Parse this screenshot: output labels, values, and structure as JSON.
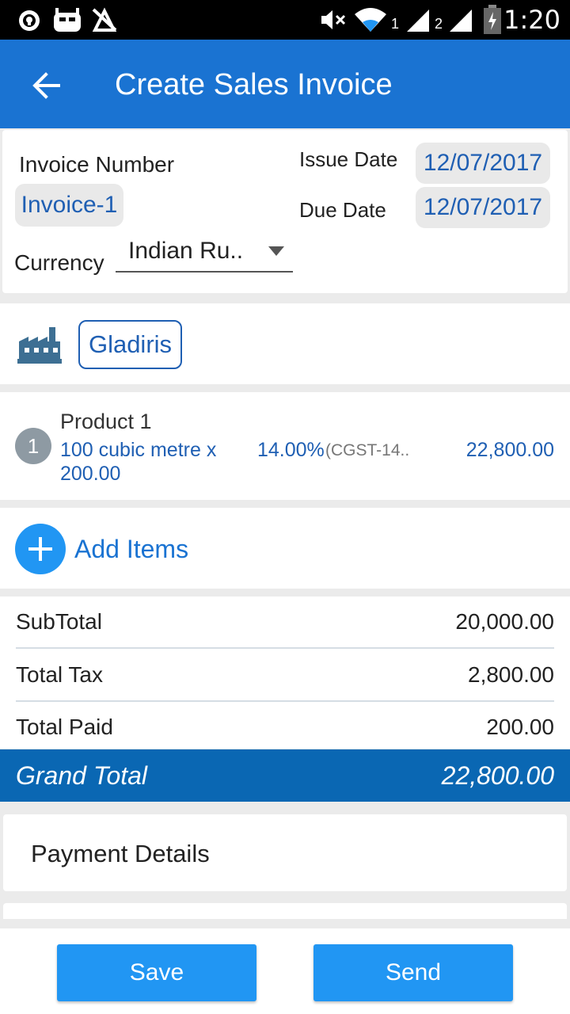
{
  "status_bar": {
    "time": "1:20",
    "sim1": "1",
    "sim2": "2",
    "icons": [
      "shield-icon",
      "cyanogen-icon",
      "no-location-icon",
      "mute-icon",
      "wifi-icon",
      "signal-icon",
      "battery-icon"
    ]
  },
  "header": {
    "title": "Create Sales Invoice",
    "back_icon": "arrow-back-icon"
  },
  "invoice": {
    "number_label": "Invoice Number",
    "number_value": "Invoice-1",
    "issue_date_label": "Issue Date",
    "issue_date_value": "12/07/2017",
    "due_date_label": "Due Date",
    "due_date_value": "12/07/2017",
    "currency_label": "Currency",
    "currency_value": "Indian Ru.."
  },
  "customer": {
    "name": "Gladiris",
    "icon": "factory-icon"
  },
  "items": [
    {
      "index": "1",
      "name": "Product 1",
      "qty_line1": "100 cubic metre x",
      "qty_line2": "200.00",
      "tax_rate": "14.00%",
      "tax_name": "(CGST-14..",
      "amount": "22,800.00"
    }
  ],
  "add_items_label": "Add Items",
  "totals": {
    "subtotal_label": "SubTotal",
    "subtotal_value": "20,000.00",
    "tax_label": "Total Tax",
    "tax_value": "2,800.00",
    "paid_label": "Total Paid",
    "paid_value": "200.00",
    "grand_label": "Grand Total",
    "grand_value": "22,800.00"
  },
  "payment_details_label": "Payment Details",
  "actions": {
    "save_label": "Save",
    "send_label": "Send"
  },
  "colors": {
    "app_bar": "#1a73d2",
    "grand_total_bar": "#0a67b3",
    "button": "#2196f3",
    "link_text": "#1f5fb3"
  }
}
